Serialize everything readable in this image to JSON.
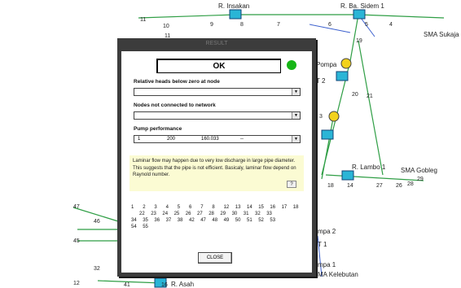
{
  "dialog": {
    "title": "RESULT",
    "status": "OK",
    "status_color": "#16b516",
    "relative_heads_label": "Relative heads below zero at node",
    "not_connected_label": "Nodes not connected to network",
    "pump_label": "Pump performance",
    "pump_row": [
      "1",
      "200",
      "160.033",
      "--"
    ],
    "note": "Laminar flow may happen due to very low discharge in large pipe diameter. This suggests that the pipe is not efficient. Basicaly, laminar flow depend on Raynold number.",
    "help_label": "?",
    "node_rows": [
      [
        "1",
        "2",
        "3",
        "4",
        "5",
        "6",
        "7",
        "8",
        "12",
        "13",
        "14",
        "15",
        "16",
        "17",
        "18"
      ],
      [
        "22",
        "23",
        "24",
        "25",
        "26",
        "27",
        "28",
        "29",
        "30",
        "31",
        "32",
        "33"
      ],
      [
        "34",
        "35",
        "36",
        "37",
        "38",
        "42",
        "47",
        "48",
        "49",
        "50",
        "51",
        "52",
        "53"
      ],
      [
        "54",
        "55"
      ]
    ],
    "close_label": "CLOSE"
  },
  "network": {
    "labels": {
      "insakan": "R. Insakan",
      "sidem": "R. Ba. Sidem 1",
      "sma_sukaja": "SMA Sukaja",
      "pompa": "Pompa",
      "t2": "T 2",
      "lambo": "R. Lambo 1",
      "sma_gobleg": "SMA Gobleg",
      "pompa2": "mpa 2",
      "t1": "T 1",
      "pompa1": "mpa 1",
      "kelebutan": "MA Kelebutan",
      "asah": "R. Asah"
    },
    "nodes": [
      "11",
      "10",
      "9",
      "8",
      "7",
      "6",
      "5",
      "4",
      "11",
      "19",
      "20",
      "21",
      "3",
      "18",
      "14",
      "27",
      "26",
      "28",
      "29",
      "47",
      "46",
      "45",
      "32",
      "41",
      "12",
      "16"
    ]
  }
}
